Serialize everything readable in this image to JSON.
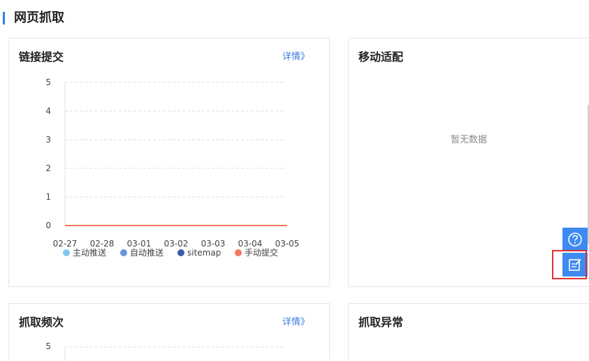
{
  "section": {
    "title": "网页抓取"
  },
  "cards": {
    "link_submit": {
      "title": "链接提交",
      "link": "详情》"
    },
    "mobile": {
      "title": "移动适配",
      "empty": "暂无数据"
    },
    "crawl_freq": {
      "title": "抓取频次",
      "link": "详情》"
    },
    "crawl_error": {
      "title": "抓取异常"
    }
  },
  "chart_data": {
    "type": "line",
    "categories": [
      "02-27",
      "02-28",
      "03-01",
      "03-02",
      "03-03",
      "03-04",
      "03-05"
    ],
    "ylim": [
      0,
      5
    ],
    "yticks": [
      "0",
      "1",
      "2",
      "3",
      "4",
      "5"
    ],
    "legend_position": "bottom",
    "grid": true,
    "series": [
      {
        "name": "主动推送",
        "color": "#7ec8f0",
        "values": [
          0,
          0,
          0,
          0,
          0,
          0,
          0
        ]
      },
      {
        "name": "自动推送",
        "color": "#6a93e0",
        "values": [
          0,
          0,
          0,
          0,
          0,
          0,
          0
        ]
      },
      {
        "name": "sitemap",
        "color": "#3a5fa8",
        "values": [
          0,
          0,
          0,
          0,
          0,
          0,
          0
        ]
      },
      {
        "name": "手动提交",
        "color": "#f07860",
        "values": [
          0,
          0,
          0,
          0,
          0,
          0,
          0
        ]
      }
    ]
  },
  "chart2": {
    "top_tick": "5"
  },
  "float": {
    "help_icon": "help-icon",
    "feedback_icon": "feedback-icon",
    "accent": "#3d8bf2"
  }
}
